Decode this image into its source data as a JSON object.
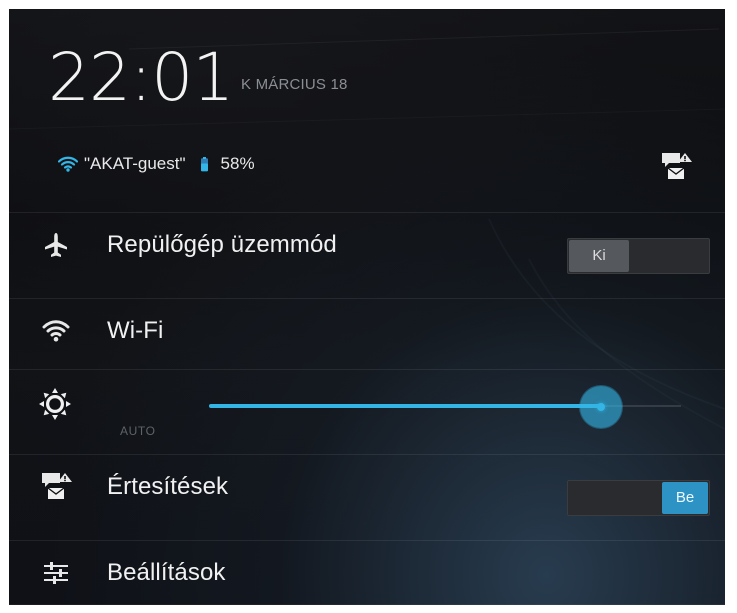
{
  "header": {
    "time": "22:01",
    "date": "K MÁRCIUS 18",
    "wifi_name": "\"AKAT-guest\"",
    "battery": "58%"
  },
  "rows": {
    "airplane": {
      "label": "Repülőgép üzemmód",
      "toggle_state": "Ki"
    },
    "wifi": {
      "label": "Wi-Fi"
    },
    "brightness": {
      "auto_label": "AUTO",
      "level": 0.83
    },
    "notifications": {
      "label": "Értesítések",
      "toggle_state": "Be"
    },
    "settings": {
      "label": "Beállítások"
    }
  },
  "icons": {
    "airplane": "airplane-icon",
    "wifi": "wifi-icon",
    "sun": "brightness-icon",
    "notification": "notification-alert-icon",
    "settings": "settings-sliders-icon",
    "battery": "battery-icon"
  },
  "colors": {
    "accent": "#33b5e5",
    "toggle_on": "#2d93c5",
    "text": "#f1f1f1",
    "muted": "#8a8f95"
  }
}
